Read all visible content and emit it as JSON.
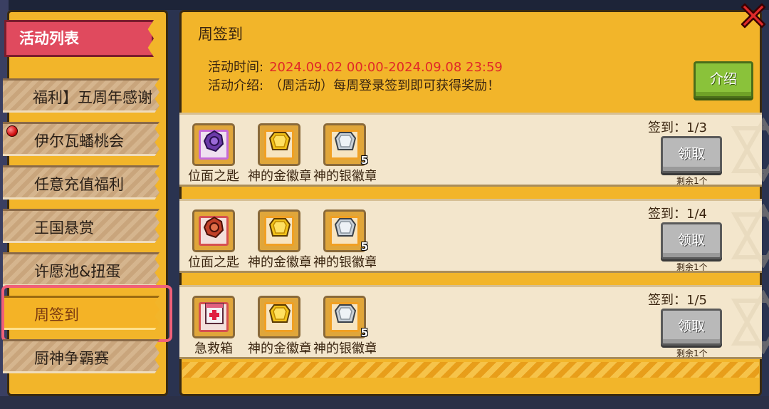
{
  "left_panel": {
    "header": "活动列表",
    "items": [
      {
        "label": "福利】五周年感谢"
      },
      {
        "label": "伊尔瓦蟠桃会"
      },
      {
        "label": "任意充值福利"
      },
      {
        "label": "王国悬赏"
      },
      {
        "label": "许愿池&扭蛋"
      },
      {
        "label": "周签到"
      },
      {
        "label": "厨神争霸赛"
      }
    ],
    "active_index": 5
  },
  "main": {
    "title": "周签到",
    "time_label": "活动时间:",
    "time_value": "2024.09.02 00:00-2024.09.08 23:59",
    "desc_label": "活动介绍:",
    "desc_value": "（周活动）每周登录签到即可获得奖励！",
    "intro_button": "介绍"
  },
  "rewards": [
    {
      "progress": "签到：1/3",
      "claim_label": "领取",
      "remain": "剩余1个",
      "items": [
        {
          "name": "位面之匙",
          "icon": "purple-key-icon",
          "count": ""
        },
        {
          "name": "神的金徽章",
          "icon": "gold-badge-icon",
          "count": ""
        },
        {
          "name": "神的银徽章",
          "icon": "silver-badge-icon",
          "count": "5"
        }
      ]
    },
    {
      "progress": "签到：1/4",
      "claim_label": "领取",
      "remain": "剩余1个",
      "items": [
        {
          "name": "位面之匙",
          "icon": "red-key-icon",
          "count": ""
        },
        {
          "name": "神的金徽章",
          "icon": "gold-badge-icon",
          "count": ""
        },
        {
          "name": "神的银徽章",
          "icon": "silver-badge-icon",
          "count": "5"
        }
      ]
    },
    {
      "progress": "签到：1/5",
      "claim_label": "领取",
      "remain": "剩余1个",
      "items": [
        {
          "name": "急救箱",
          "icon": "first-aid-kit-icon",
          "count": ""
        },
        {
          "name": "神的金徽章",
          "icon": "gold-badge-icon",
          "count": ""
        },
        {
          "name": "神的银徽章",
          "icon": "silver-badge-icon",
          "count": "5"
        }
      ]
    }
  ],
  "colors": {
    "panel": "#f2b52a",
    "accent_red": "#e02828",
    "header_red": "#e04a5e",
    "intro_green": "#8ac23a",
    "claim_gray": "#b9b9b9"
  }
}
